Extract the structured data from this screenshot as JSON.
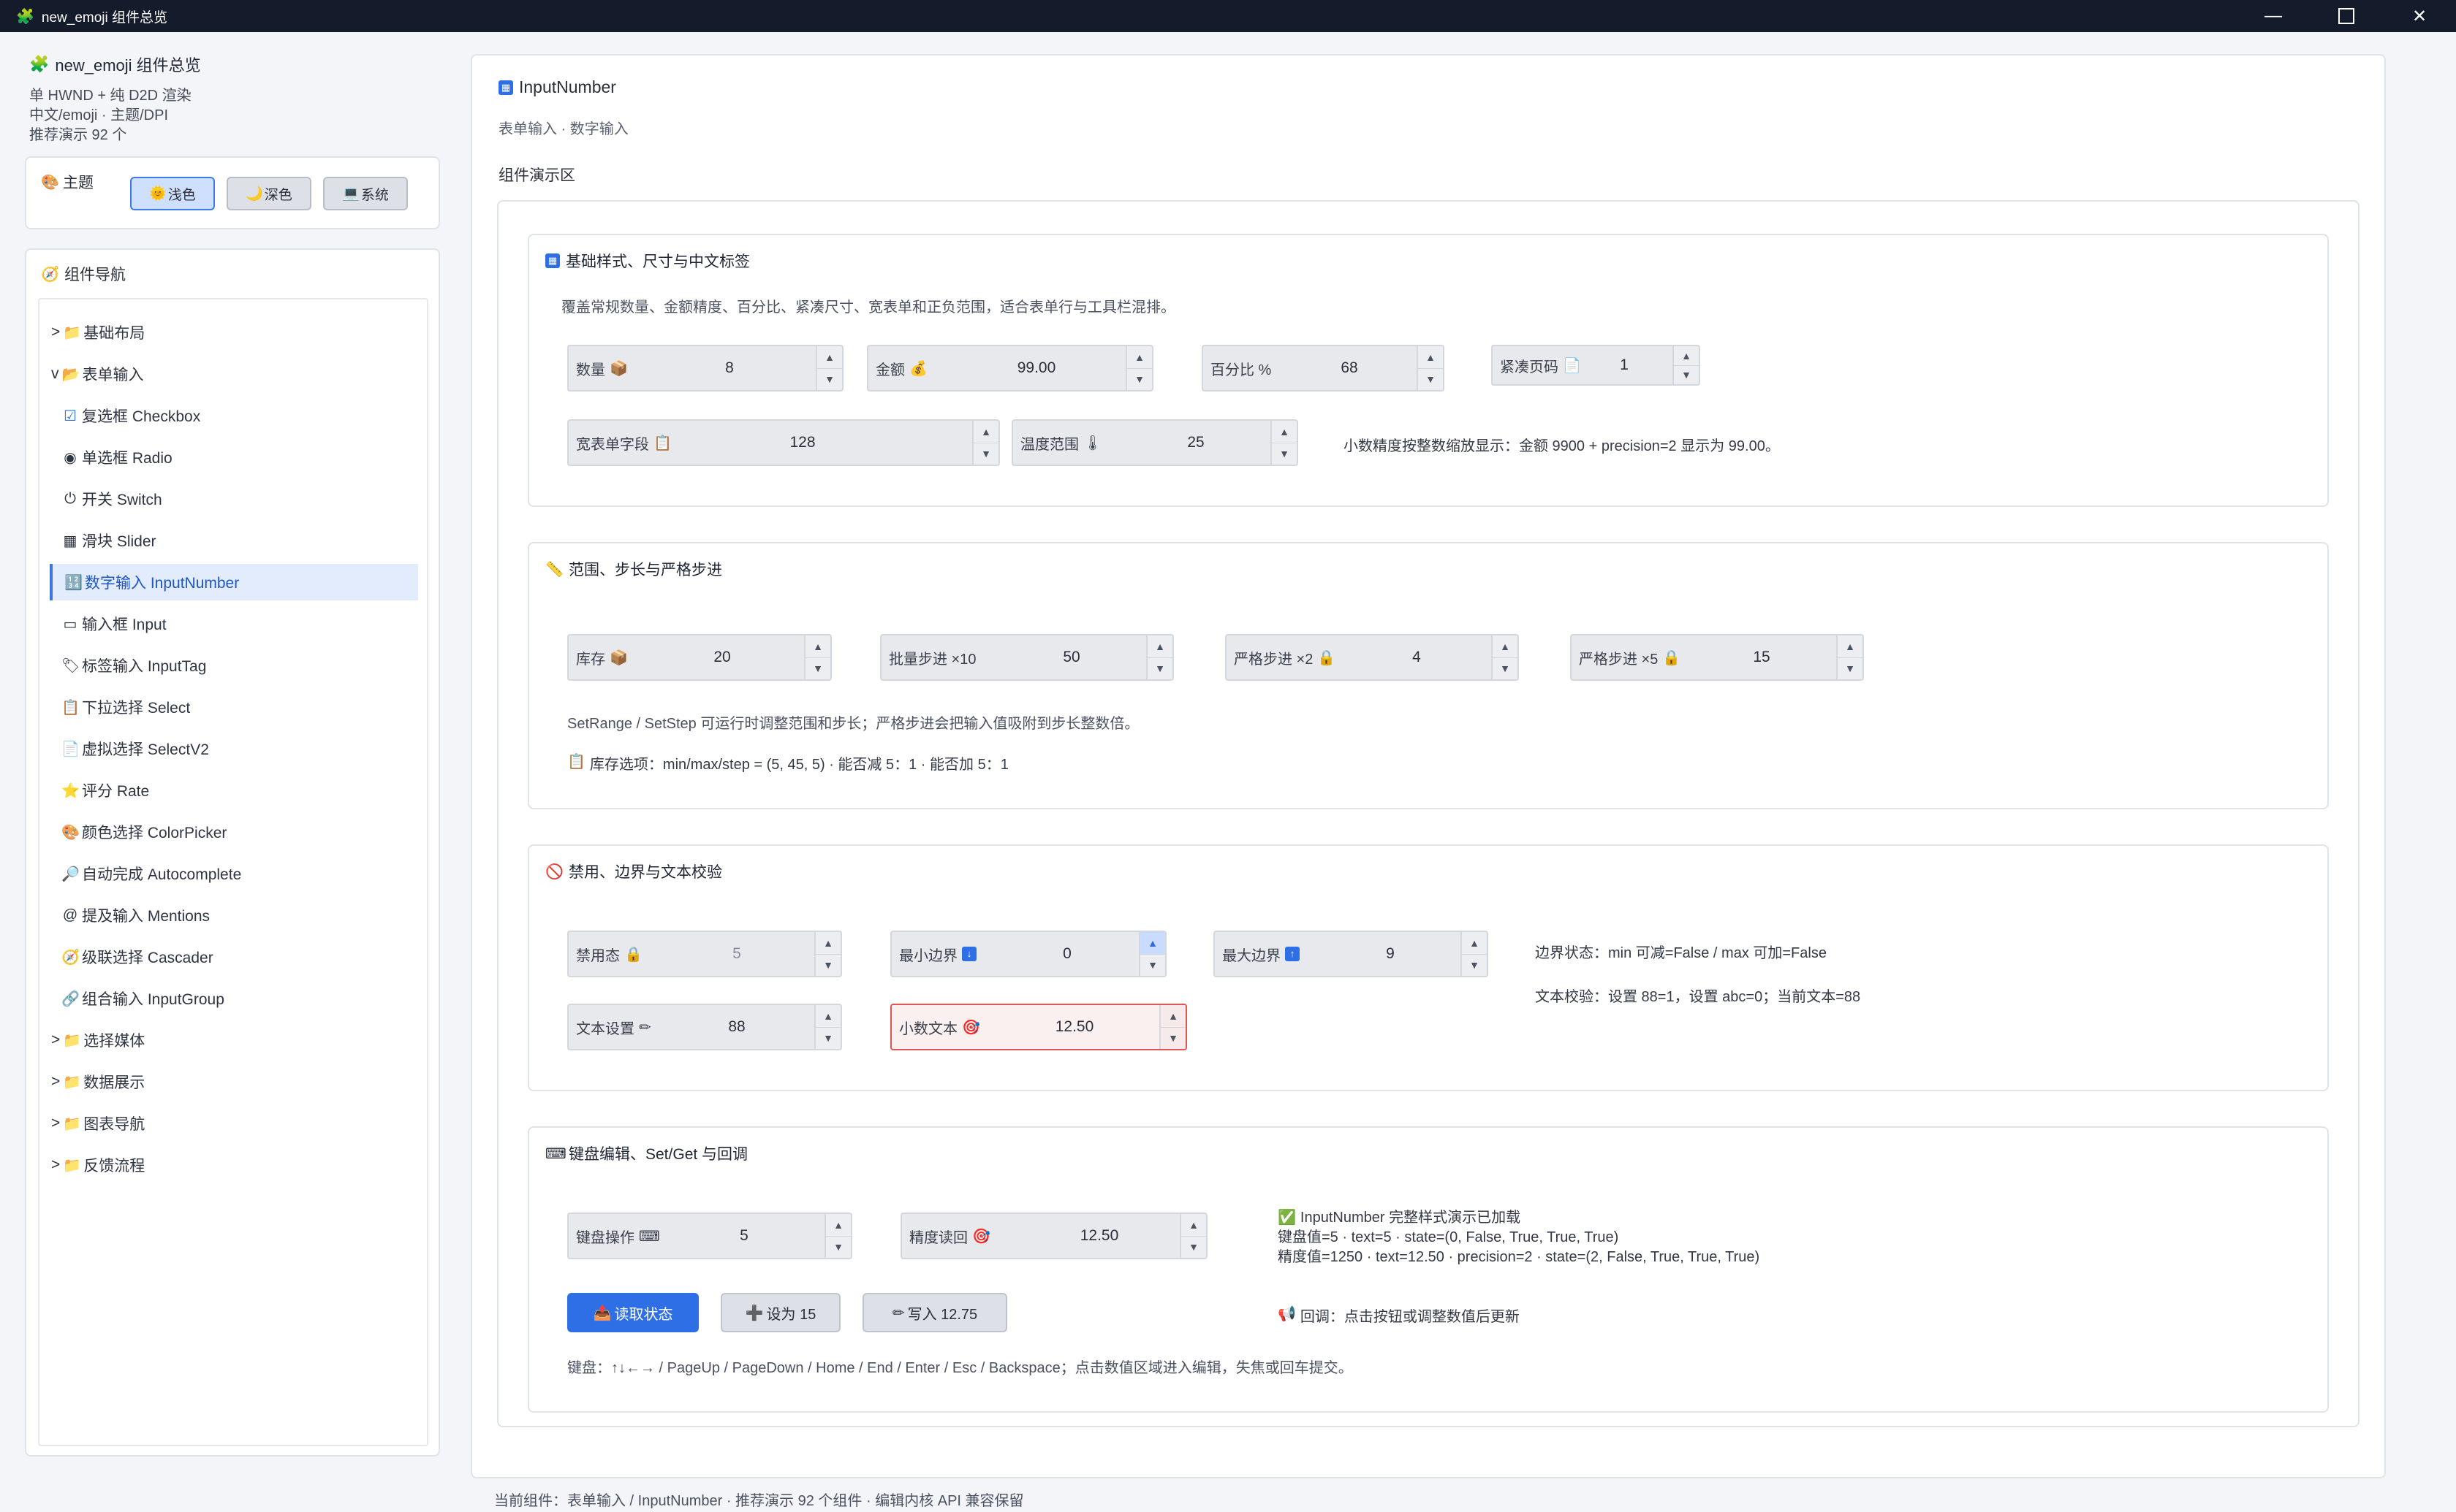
{
  "window": {
    "title": "new_emoji 组件总览",
    "icon": "🧩"
  },
  "sidebar": {
    "title": "new_emoji 组件总览",
    "lines": [
      "单 HWND + 纯 D2D 渲染",
      "中文/emoji · 主题/DPI",
      "推荐演示 92 个"
    ],
    "theme": {
      "label": "主题",
      "icon": "🎨",
      "buttons": [
        {
          "icon": "🌞",
          "label": "浅色"
        },
        {
          "icon": "🌙",
          "label": "深色"
        },
        {
          "icon": "💻",
          "label": "系统"
        }
      ]
    },
    "nav": {
      "title": "组件导航",
      "icon": "🧭",
      "items": [
        {
          "prefix": ">",
          "icon": "📁",
          "label": "基础布局"
        },
        {
          "prefix": "v",
          "icon": "📂",
          "label": "表单输入"
        },
        {
          "icon": "☑",
          "label": "复选框 Checkbox"
        },
        {
          "icon": "◉",
          "label": "单选框 Radio"
        },
        {
          "icon": "⏻",
          "label": "开关 Switch"
        },
        {
          "icon": "▦",
          "label": "滑块 Slider"
        },
        {
          "icon": "🔢",
          "label": "数字输入 InputNumber"
        },
        {
          "icon": "▭",
          "label": "输入框 Input"
        },
        {
          "icon": "🏷",
          "label": "标签输入 InputTag"
        },
        {
          "icon": "📋",
          "label": "下拉选择 Select"
        },
        {
          "icon": "📄",
          "label": "虚拟选择 SelectV2"
        },
        {
          "icon": "⭐",
          "label": "评分 Rate"
        },
        {
          "icon": "🎨",
          "label": "颜色选择 ColorPicker"
        },
        {
          "icon": "🔎",
          "label": "自动完成 Autocomplete"
        },
        {
          "icon": "@",
          "label": "提及输入 Mentions"
        },
        {
          "icon": "🧭",
          "label": "级联选择 Cascader"
        },
        {
          "icon": "🔗",
          "label": "组合输入 InputGroup"
        },
        {
          "prefix": ">",
          "icon": "📁",
          "label": "选择媒体"
        },
        {
          "prefix": ">",
          "icon": "📁",
          "label": "数据展示"
        },
        {
          "prefix": ">",
          "icon": "📁",
          "label": "图表导航"
        },
        {
          "prefix": ">",
          "icon": "📁",
          "label": "反馈流程"
        }
      ]
    }
  },
  "main": {
    "title": "InputNumber",
    "subtitle": "表单输入 · 数字输入",
    "demo_label": "组件演示区",
    "sections": {
      "basic": {
        "title": "基础样式、尺寸与中文标签",
        "icon": "🔢",
        "desc": "覆盖常规数量、金额精度、百分比、紧凑尺寸、宽表单和正负范围，适合表单行与工具栏混排。",
        "inputs": [
          {
            "label": "数量",
            "icon": "📦",
            "value": "8"
          },
          {
            "label": "金额",
            "icon": "💰",
            "value": "99.00"
          },
          {
            "label": "百分比 %",
            "icon": "",
            "value": "68"
          },
          {
            "label": "紧凑页码",
            "icon": "📄",
            "value": "1"
          },
          {
            "label": "宽表单字段",
            "icon": "📋",
            "value": "128"
          },
          {
            "label": "温度范围",
            "icon": "🌡",
            "value": "25"
          }
        ],
        "note": "小数精度按整数缩放显示：金额 9900 + precision=2 显示为 99.00。"
      },
      "range": {
        "title": "范围、步长与严格步进",
        "icon": "📏",
        "inputs": [
          {
            "label": "库存",
            "icon": "📦",
            "value": "20"
          },
          {
            "label": "批量步进 ×10",
            "icon": "",
            "value": "50"
          },
          {
            "label": "严格步进 ×2",
            "icon": "🔒",
            "value": "4"
          },
          {
            "label": "严格步进 ×5",
            "icon": "🔒",
            "value": "15"
          }
        ],
        "note1": "SetRange / SetStep 可运行时调整范围和步长；严格步进会把输入值吸附到步长整数倍。",
        "note2_icon": "📋",
        "note2": "库存选项：min/max/step = (5, 45, 5) · 能否减 5：1 · 能否加 5：1"
      },
      "disabled": {
        "title": "禁用、边界与文本校验",
        "icon": "🚫",
        "inputs": [
          {
            "label": "禁用态",
            "icon": "🔒",
            "value": "5"
          },
          {
            "label": "最小边界",
            "icon": "⬇",
            "value": "0"
          },
          {
            "label": "最大边界",
            "icon": "⬆",
            "value": "9"
          },
          {
            "label": "文本设置",
            "icon": "✏",
            "value": "88"
          },
          {
            "label": "小数文本",
            "icon": "🎯",
            "value": "12.50"
          }
        ],
        "note1": "边界状态：min 可减=False / max 可加=False",
        "note2": "文本校验：设置 88=1，设置 abc=0；当前文本=88"
      },
      "keyboard": {
        "title": "键盘编辑、Set/Get 与回调",
        "icon": "⌨",
        "inputs": [
          {
            "label": "键盘操作",
            "icon": "⌨",
            "value": "5"
          },
          {
            "label": "精度读回",
            "icon": "🎯",
            "value": "12.50"
          }
        ],
        "status_icon": "✅",
        "status1": "InputNumber 完整样式演示已加载",
        "status2": "键盘值=5 · text=5 · state=(0, False, True, True, True)",
        "status3": "精度值=1250 · text=12.50 · precision=2 · state=(2, False, True, True, True)",
        "buttons": [
          {
            "icon": "📤",
            "label": "读取状态"
          },
          {
            "icon": "➕",
            "label": "设为 15"
          },
          {
            "icon": "✏",
            "label": "写入 12.75"
          }
        ],
        "callback_icon": "📢",
        "callback": "回调：点击按钮或调整数值后更新",
        "hint": "键盘：↑↓←→ / PageUp / PageDown / Home / End / Enter / Esc / Backspace；点击数值区域进入编辑，失焦或回车提交。"
      }
    }
  },
  "status_bar": "当前组件：表单输入 / InputNumber · 推荐演示 92 个组件 · 编辑内核 API 兼容保留"
}
